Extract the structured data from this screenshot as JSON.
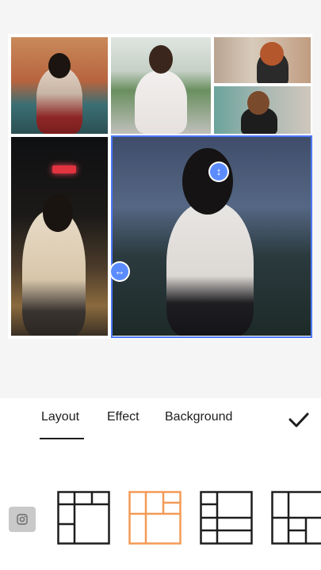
{
  "tabs": {
    "layout": "Layout",
    "effect": "Effect",
    "background": "Background"
  },
  "icons": {
    "confirm": "check-icon",
    "swap_vertical": "vertical-resize-handle-icon",
    "swap_horizontal": "horizontal-resize-handle-icon",
    "small_button": "instagram-icon"
  },
  "colors": {
    "accent": "#5b8cff",
    "selected_layout": "#f39a57",
    "layout_stroke": "#1d1d1d"
  },
  "layouts": [
    {
      "name": "layout-option-1",
      "selected": false
    },
    {
      "name": "layout-option-2",
      "selected": true
    },
    {
      "name": "layout-option-3",
      "selected": false
    },
    {
      "name": "layout-option-4",
      "selected": false
    }
  ]
}
